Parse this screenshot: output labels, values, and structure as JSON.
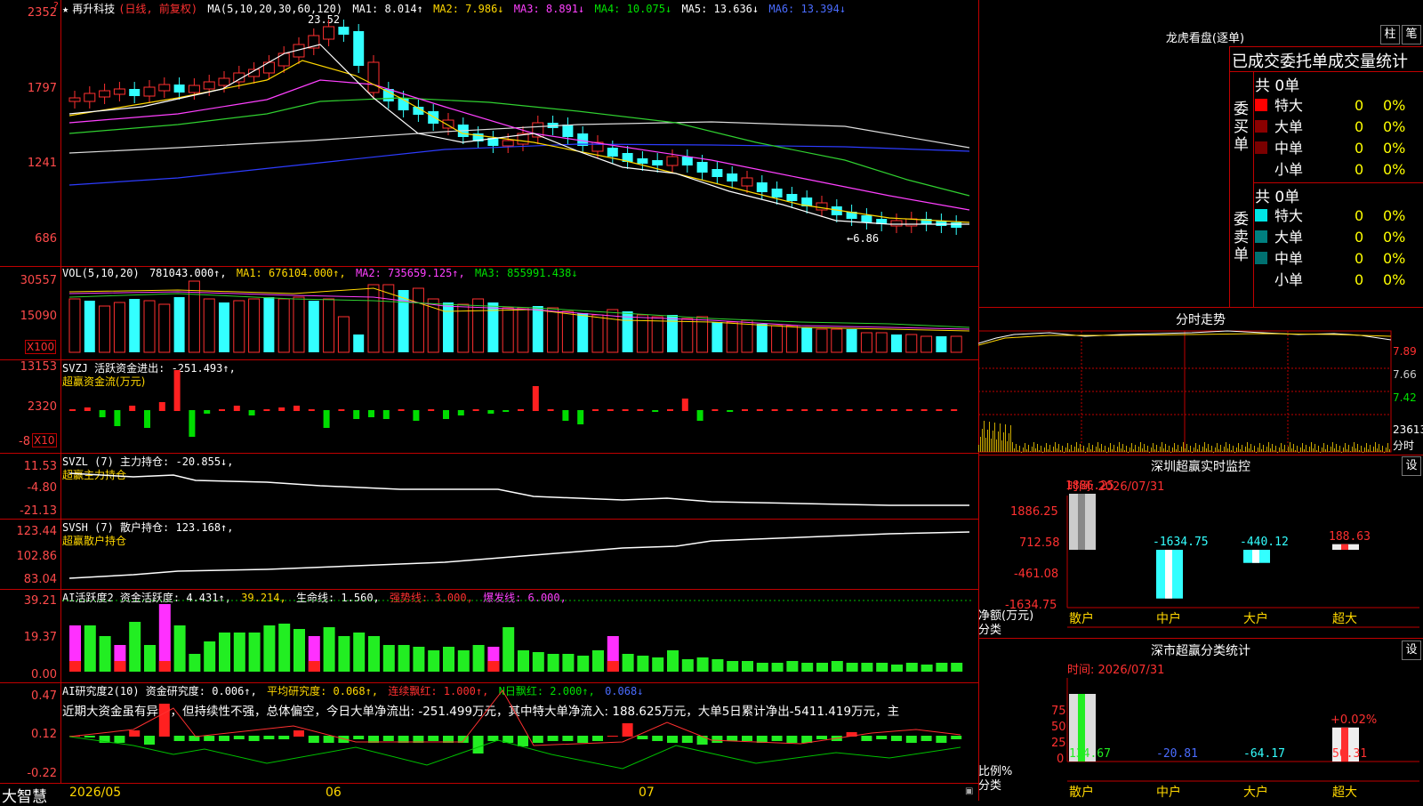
{
  "main_chart": {
    "star": "★",
    "stock_name": "再升科技",
    "period": "(日线, 前复权)",
    "ma_title": "MA(5,10,20,30,60,120)",
    "ma1": "MA1: 8.014↑",
    "ma2": "MA2: 7.986↓",
    "ma3": "MA3: 8.891↓",
    "ma4": "MA4: 10.075↓",
    "ma5": "MA5: 13.636↓",
    "ma6": "MA6: 13.394↓",
    "y_ticks": [
      "2352",
      "1797",
      "1241",
      "686"
    ],
    "high_note": "23.52",
    "low_note": "←6.86",
    "corner_mark": "?"
  },
  "volume": {
    "title": "VOL(5,10,20)",
    "value": "781043.000↑,",
    "ma1": "MA1: 676104.000↑,",
    "ma2": "MA2: 735659.125↑,",
    "ma3": "MA3: 855991.438↓",
    "y_ticks": [
      "30557",
      "15090"
    ],
    "unit": "X100"
  },
  "svzj": {
    "title": "SVZJ  活跃资金进出: -251.493↑,",
    "subtitle": "超赢资金流(万元)",
    "y_ticks": [
      "13153",
      "2320",
      "-8"
    ],
    "unit": "X10"
  },
  "svzl": {
    "title": "SVZL (7) 主力持仓: -20.855↓,",
    "subtitle": "超赢主力持仓",
    "y_ticks": [
      "11.53",
      "-4.80",
      "-21.13"
    ]
  },
  "svsh": {
    "title": "SVSH (7) 散户持仓: 123.168↑,",
    "subtitle": "超赢散户持仓",
    "y_ticks": [
      "123.44",
      "102.86",
      "83.04"
    ]
  },
  "ai_active": {
    "title": "AI活跃度2 资金活跃度: 4.431↑,",
    "v2": "39.214,",
    "life": "生命线: 1.560,",
    "strong": "强势线: 3.000,",
    "burst": "爆发线: 6.000,",
    "y_ticks": [
      "39.21",
      "19.37",
      "0.00"
    ]
  },
  "ai_research": {
    "title": "AI研究度2(10) 资金研究度: 0.006↑,",
    "avg": "平均研究度: 0.068↑,",
    "cont": "连续飘红: 1.000↑,",
    "nday": "N日飘红: 2.000↑,",
    "last": "0.068↓",
    "commentary": "近期大资金虽有异动，但持续性不强，总体偏空，今日大单净流出: -251.499万元，其中特大单净流入: 188.625万元，大单5日累计净出-5411.419万元，主",
    "y_ticks": [
      "0.47",
      "0.12",
      "-0.22"
    ]
  },
  "x_axis": {
    "logo": "大智慧",
    "labels": [
      "2026/05",
      "06",
      "07"
    ]
  },
  "dragon_tiger": {
    "title": "龙虎看盘(逐单)",
    "btn1": "柱",
    "btn2": "笔",
    "header": "已成交委托单成交量统计",
    "buy_label": "委买单",
    "sell_label": "委卖单",
    "buy_total": "共 0单",
    "sell_total": "共 0单",
    "buy_rows": [
      {
        "name": "特大",
        "count": "0",
        "pct": "0%",
        "color": "#ff0000"
      },
      {
        "name": "大单",
        "count": "0",
        "pct": "0%",
        "color": "#8b0000"
      },
      {
        "name": "中单",
        "count": "0",
        "pct": "0%",
        "color": "#7a0000"
      },
      {
        "name": "小单",
        "count": "0",
        "pct": "0%",
        "color": ""
      }
    ],
    "sell_rows": [
      {
        "name": "特大",
        "count": "0",
        "pct": "0%",
        "color": "#00e5e5"
      },
      {
        "name": "大单",
        "count": "0",
        "pct": "0%",
        "color": "#008080"
      },
      {
        "name": "中单",
        "count": "0",
        "pct": "0%",
        "color": "#007070"
      },
      {
        "name": "小单",
        "count": "0",
        "pct": "0%",
        "color": ""
      }
    ]
  },
  "intraday": {
    "title": "分时走势",
    "y_ticks": [
      "7.89",
      "7.66",
      "7.42"
    ],
    "vol_label": "23613",
    "vol_unit": "分时"
  },
  "monitor": {
    "title": "深圳超赢实时监控",
    "settings": "设",
    "time": "时间: 2026/07/31",
    "y_ticks": [
      "1886.25",
      "712.58",
      "-461.08",
      "-1634.75"
    ],
    "axis_label": "净额(万元)",
    "axis_label2": "分类",
    "categories": [
      "散户",
      "中户",
      "大户",
      "超大"
    ],
    "values": [
      1886.25,
      -1634.75,
      -440.12,
      188.63
    ],
    "value_labels": [
      "1886.25",
      "-1634.75",
      "-440.12",
      "188.63"
    ]
  },
  "classification": {
    "title": "深市超赢分类统计",
    "settings": "设",
    "time": "时间: 2026/07/31",
    "y_ticks": [
      "75",
      "50",
      "25",
      "0"
    ],
    "axis_label": "比例%",
    "axis_label2": "分类",
    "top_label": "+0.02%",
    "categories": [
      "散户",
      "中户",
      "大户",
      "超大"
    ],
    "values": [
      134.67,
      -20.81,
      -64.17,
      50.31
    ],
    "value_labels": [
      "134.67",
      "-20.81",
      "-64.17",
      "50.31"
    ]
  }
}
